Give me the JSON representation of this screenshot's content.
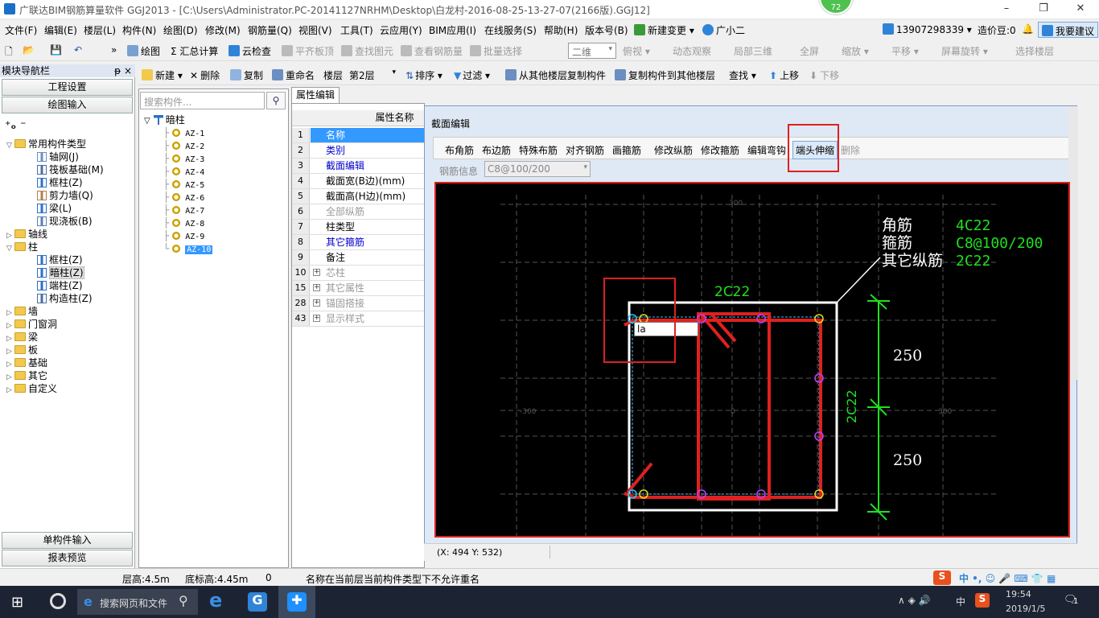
{
  "window": {
    "title": "广联达BIM钢筋算量软件 GGJ2013 - [C:\\Users\\Administrator.PC-20141127NRHM\\Desktop\\白龙村-2016-08-25-13-27-07(2166版).GGJ12]",
    "badge": "72",
    "controls": [
      "–",
      "❐",
      "✕"
    ]
  },
  "menubar": {
    "items": [
      "文件(F)",
      "编辑(E)",
      "楼层(L)",
      "构件(N)",
      "绘图(D)",
      "修改(M)",
      "钢筋量(Q)",
      "视图(V)",
      "工具(T)",
      "云应用(Y)",
      "BIM应用(I)",
      "在线服务(S)",
      "帮助(H)",
      "版本号(B)",
      "新建变更 ▾",
      "广小二"
    ],
    "phone": "13907298339 ▾",
    "price": "造价豆:0",
    "suggest": "我要建议"
  },
  "toolbar1": {
    "items": [
      "绘图",
      "Σ 汇总计算",
      "云检查",
      "平齐板顶",
      "查找图元",
      "查看钢筋量",
      "批量选择"
    ],
    "view_select": "二维",
    "view_items": [
      "俯视 ▾",
      "动态观察",
      "局部三维",
      "全屏",
      "缩放 ▾",
      "平移 ▾",
      "屏幕旋转 ▾",
      "选择楼层"
    ]
  },
  "toolbar2": {
    "items": [
      "新建 ▾",
      "删除",
      "复制",
      "重命名",
      "楼层",
      "第2层",
      "排序 ▾",
      "过滤 ▾",
      "从其他楼层复制构件",
      "复制构件到其他楼层",
      "查找 ▾",
      "上移",
      "下移"
    ]
  },
  "left_panel": {
    "header": "模块导航栏",
    "pin": "ᵽ ×",
    "buttons": [
      "工程设置",
      "绘图输入"
    ],
    "bottom_buttons": [
      "单构件输入",
      "报表预览"
    ],
    "tree": [
      {
        "label": "常用构件类型",
        "level": 0,
        "kind": "folder",
        "expanded": true
      },
      {
        "label": "轴网(J)",
        "level": 1,
        "kind": "grid"
      },
      {
        "label": "筏板基础(M)",
        "level": 1,
        "kind": "slab"
      },
      {
        "label": "框柱(Z)",
        "level": 1,
        "kind": "col"
      },
      {
        "label": "剪力墙(Q)",
        "level": 1,
        "kind": "wall"
      },
      {
        "label": "梁(L)",
        "level": 1,
        "kind": "beam"
      },
      {
        "label": "现浇板(B)",
        "level": 1,
        "kind": "slab2"
      },
      {
        "label": "轴线",
        "level": 0,
        "kind": "folder"
      },
      {
        "label": "柱",
        "level": 0,
        "kind": "folder",
        "expanded": true
      },
      {
        "label": "框柱(Z)",
        "level": 1,
        "kind": "col"
      },
      {
        "label": "暗柱(Z)",
        "level": 1,
        "kind": "col",
        "selected": true
      },
      {
        "label": "端柱(Z)",
        "level": 1,
        "kind": "col"
      },
      {
        "label": "构造柱(Z)",
        "level": 1,
        "kind": "col2"
      },
      {
        "label": "墙",
        "level": 0,
        "kind": "folder"
      },
      {
        "label": "门窗洞",
        "level": 0,
        "kind": "folder"
      },
      {
        "label": "梁",
        "level": 0,
        "kind": "folder"
      },
      {
        "label": "板",
        "level": 0,
        "kind": "folder"
      },
      {
        "label": "基础",
        "level": 0,
        "kind": "folder"
      },
      {
        "label": "其它",
        "level": 0,
        "kind": "folder"
      },
      {
        "label": "自定义",
        "level": 0,
        "kind": "folder"
      }
    ]
  },
  "component_list": {
    "search_placeholder": "搜索构件...",
    "root": "暗柱",
    "items": [
      "AZ-1",
      "AZ-2",
      "AZ-3",
      "AZ-4",
      "AZ-5",
      "AZ-6",
      "AZ-7",
      "AZ-8",
      "AZ-9",
      "AZ-10"
    ],
    "selected": "AZ-10"
  },
  "properties": {
    "tab": "属性编辑",
    "header": "属性名称",
    "rows": [
      {
        "num": "1",
        "name": "名称",
        "style": "sel"
      },
      {
        "num": "2",
        "name": "类别",
        "style": "blue"
      },
      {
        "num": "3",
        "name": "截面编辑",
        "style": "blue"
      },
      {
        "num": "4",
        "name": "截面宽(B边)(mm)",
        "style": ""
      },
      {
        "num": "5",
        "name": "截面高(H边)(mm)",
        "style": ""
      },
      {
        "num": "6",
        "name": "全部纵筋",
        "style": "gray"
      },
      {
        "num": "7",
        "name": "柱类型",
        "style": ""
      },
      {
        "num": "8",
        "name": "其它箍筋",
        "style": "blue"
      },
      {
        "num": "9",
        "name": "备注",
        "style": ""
      },
      {
        "num": "10",
        "name": "芯柱",
        "style": "gray",
        "plus": true
      },
      {
        "num": "15",
        "name": "其它属性",
        "style": "gray",
        "plus": true
      },
      {
        "num": "28",
        "name": "锚固搭接",
        "style": "gray",
        "plus": true
      },
      {
        "num": "43",
        "name": "显示样式",
        "style": "gray",
        "plus": true
      }
    ]
  },
  "section_editor": {
    "title": "截面编辑",
    "buttons": [
      "布角筋",
      "布边筋",
      "特殊布筋",
      "对齐钢筋",
      "画箍筋",
      "修改纵筋",
      "修改箍筋",
      "编辑弯钩",
      "端头伸缩",
      "删除"
    ],
    "rebar_info_label": "钢筋信息",
    "rebar_info_value": "C8@100/200",
    "coord": "(X: 494 Y: 532)",
    "canvas": {
      "legend_labels": [
        "角筋",
        "箍筋",
        "其它纵筋"
      ],
      "legend_values": [
        "4C22",
        "C8@100/200",
        "2C22"
      ],
      "top_label": "2C22",
      "side_label": "2C22",
      "dims": [
        "250",
        "250"
      ],
      "axis_labels": [
        "300",
        "-300",
        "0",
        "300"
      ],
      "input_text": "la"
    }
  },
  "statusbar": {
    "floor_height": "层高:4.5m",
    "base_height": "底标高:4.45m",
    "zero": "0",
    "message": "名称在当前层当前构件类型下不允许重名"
  },
  "taskbar": {
    "search": "搜索网页和文件",
    "time": "19:54",
    "date": "2019/1/5",
    "ime": "中",
    "notif": "1"
  }
}
